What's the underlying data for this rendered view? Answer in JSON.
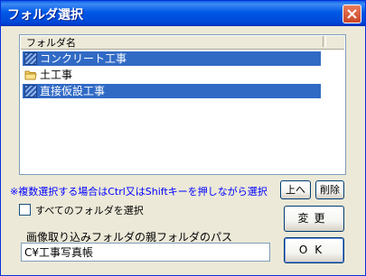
{
  "window": {
    "title": "フォルダ選択"
  },
  "list": {
    "column_header": "フォルダ名",
    "items": [
      {
        "label": "コンクリート工事",
        "selected": true,
        "icon": "hatched-folder-icon"
      },
      {
        "label": "土工事",
        "selected": false,
        "icon": "folder-icon"
      },
      {
        "label": "直接仮設工事",
        "selected": true,
        "icon": "hatched-folder-icon"
      }
    ]
  },
  "note": "※複数選択する場合はCtrl又はShiftキーを押しながら選択",
  "buttons": {
    "up": "上へ",
    "delete": "削除",
    "change": "変更",
    "ok": "OK"
  },
  "select_all": {
    "label": "すべてのフォルダを選択",
    "checked": false
  },
  "path": {
    "label": "画像取り込みフォルダの親フォルダのパス",
    "value": "C¥工事写真帳"
  },
  "colors": {
    "title_bar": "#0058e6",
    "selection": "#316ac5",
    "note_text": "#0000ff"
  }
}
